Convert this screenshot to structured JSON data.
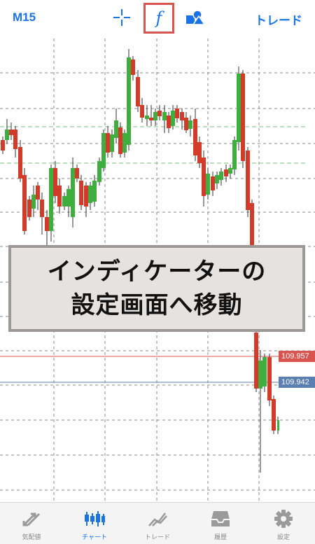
{
  "header": {
    "timeframe": "M15",
    "crosshair_icon": "crosshair-icon",
    "indicator_icon": "function-f-icon",
    "indicator_symbol": "f",
    "objects_icon": "shapes-icon",
    "trade_label": "トレード",
    "accent_color": "#1a73e8",
    "highlight_color": "#d9534f"
  },
  "chart": {
    "price_lines": [
      {
        "label": "109.957",
        "color": "#d9534f"
      },
      {
        "label": "109.942",
        "color": "#5a7fb0"
      }
    ],
    "bull_color": "#3fae3f",
    "bear_color": "#d23b2a"
  },
  "overlay": {
    "line1": "インディケーターの",
    "line2": "設定画面へ移動"
  },
  "tabbar": {
    "items": [
      {
        "label": "気配値",
        "icon": "quotes-arrows-icon"
      },
      {
        "label": "チャート",
        "icon": "candlestick-chart-icon",
        "active": true
      },
      {
        "label": "トレード",
        "icon": "trade-trend-icon"
      },
      {
        "label": "履歴",
        "icon": "history-inbox-icon"
      },
      {
        "label": "設定",
        "icon": "settings-gear-icon"
      }
    ]
  }
}
